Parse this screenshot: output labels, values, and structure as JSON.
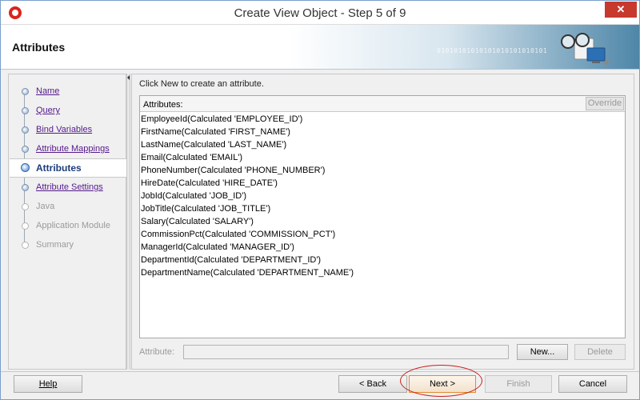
{
  "window": {
    "title": "Create View Object - Step 5 of 9",
    "close_label": "✕"
  },
  "header": {
    "title": "Attributes",
    "decoration_text": "01010101010101010101010101"
  },
  "sidebar": {
    "items": [
      {
        "label": "Name",
        "state": "done"
      },
      {
        "label": "Query",
        "state": "done"
      },
      {
        "label": "Bind Variables",
        "state": "done"
      },
      {
        "label": "Attribute Mappings",
        "state": "done"
      },
      {
        "label": "Attributes",
        "state": "current"
      },
      {
        "label": "Attribute Settings",
        "state": "done"
      },
      {
        "label": "Java",
        "state": "todo"
      },
      {
        "label": "Application Module",
        "state": "todo"
      },
      {
        "label": "Summary",
        "state": "todo"
      }
    ]
  },
  "main": {
    "hint": "Click New to create an attribute.",
    "list_header": "Attributes:",
    "override_label": "Override",
    "attributes": [
      "EmployeeId(Calculated 'EMPLOYEE_ID')",
      "FirstName(Calculated 'FIRST_NAME')",
      "LastName(Calculated 'LAST_NAME')",
      "Email(Calculated 'EMAIL')",
      "PhoneNumber(Calculated 'PHONE_NUMBER')",
      "HireDate(Calculated 'HIRE_DATE')",
      "JobId(Calculated 'JOB_ID')",
      "JobTitle(Calculated 'JOB_TITLE')",
      "Salary(Calculated 'SALARY')",
      "CommissionPct(Calculated 'COMMISSION_PCT')",
      "ManagerId(Calculated 'MANAGER_ID')",
      "DepartmentId(Calculated 'DEPARTMENT_ID')",
      "DepartmentName(Calculated 'DEPARTMENT_NAME')"
    ],
    "attribute_label": "Attribute:",
    "attribute_value": "",
    "new_label": "New...",
    "delete_label": "Delete"
  },
  "footer": {
    "help_label": "Help",
    "back_label": "< Back",
    "next_label": "Next >",
    "finish_label": "Finish",
    "cancel_label": "Cancel"
  },
  "colors": {
    "current_step": "#1e3c78",
    "visited_link": "#551a8b",
    "annotation": "#c8201c",
    "next_border": "#e48a2a"
  }
}
